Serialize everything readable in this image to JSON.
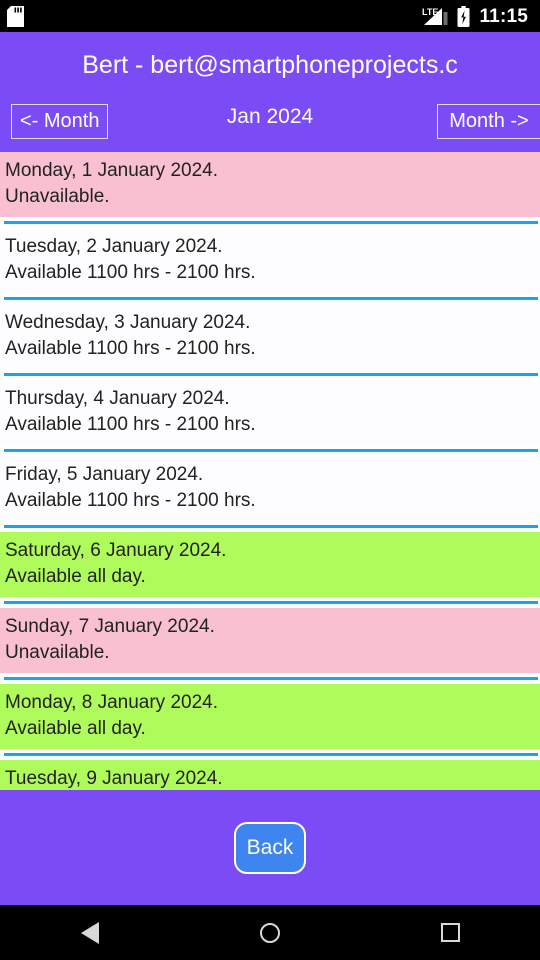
{
  "status_bar": {
    "time": "11:15",
    "icons": [
      "sd-card-icon",
      "lte-signal-icon",
      "battery-charging-icon"
    ]
  },
  "app_bar": {
    "title": "Bert - bert@smartphoneprojects.c"
  },
  "month_nav": {
    "prev_label": "<- Month",
    "next_label": "Month ->",
    "current_month": "Jan 2024"
  },
  "colors": {
    "header_purple": "#7b4cf5",
    "available_green": "#b0fb5c",
    "unavailable_pink": "#f8c0d0",
    "partial_white": "#fdfdff",
    "separator_blue": "#18a5ec",
    "back_button_blue": "#3e85ef"
  },
  "days": [
    {
      "date": "Monday,  1 January 2024.",
      "status": "Unavailable.",
      "state": "unavailable"
    },
    {
      "date": "Tuesday,  2 January 2024.",
      "status": "Available 1100 hrs - 2100 hrs.",
      "state": "partial"
    },
    {
      "date": "Wednesday,  3 January 2024.",
      "status": "Available 1100 hrs - 2100 hrs.",
      "state": "partial"
    },
    {
      "date": "Thursday,  4 January 2024.",
      "status": "Available 1100 hrs - 2100 hrs.",
      "state": "partial"
    },
    {
      "date": "Friday,  5 January 2024.",
      "status": "Available 1100 hrs - 2100 hrs.",
      "state": "partial"
    },
    {
      "date": "Saturday,  6 January 2024.",
      "status": "Available all day.",
      "state": "available"
    },
    {
      "date": "Sunday,  7 January 2024.",
      "status": "Unavailable.",
      "state": "unavailable"
    },
    {
      "date": "Monday,  8 January 2024.",
      "status": "Available all day.",
      "state": "available"
    },
    {
      "date": "Tuesday,  9 January 2024.",
      "status": "",
      "state": "available"
    }
  ],
  "footer": {
    "back_label": "Back"
  },
  "navigation_bar": {
    "back": "back-triangle-icon",
    "home": "home-circle-icon",
    "recents": "recents-square-icon"
  }
}
